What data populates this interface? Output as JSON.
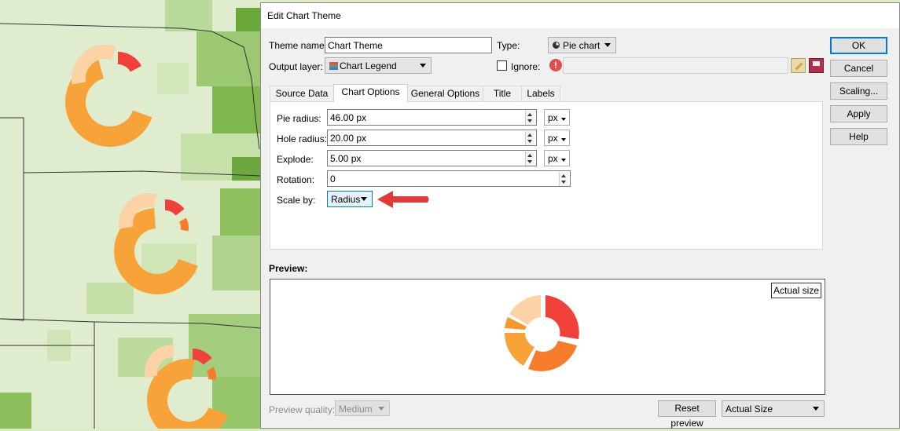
{
  "dialog": {
    "title": "Edit Chart Theme",
    "theme_name_label": "Theme name:",
    "theme_name_value": "Chart Theme",
    "type_label": "Type:",
    "type_value": "Pie chart",
    "output_layer_label": "Output layer:",
    "output_layer_value": "Chart Legend",
    "ignore_label": "Ignore:",
    "ignore_value": "",
    "buttons": {
      "ok": "OK",
      "cancel": "Cancel",
      "scaling": "Scaling...",
      "apply": "Apply",
      "help": "Help"
    },
    "tabs": [
      "Source Data",
      "Chart Options",
      "General Options",
      "Title",
      "Labels"
    ],
    "active_tab": "Chart Options",
    "chart_options": {
      "pie_radius_label": "Pie radius:",
      "pie_radius_value": "46.00 px",
      "pie_radius_unit": "px",
      "hole_radius_label": "Hole radius:",
      "hole_radius_value": "20.00 px",
      "hole_radius_unit": "px",
      "explode_label": "Explode:",
      "explode_value": "5.00 px",
      "explode_unit": "px",
      "rotation_label": "Rotation:",
      "rotation_value": "0",
      "scale_by_label": "Scale by:",
      "scale_by_value": "Radius"
    },
    "preview": {
      "label": "Preview:",
      "actual_size_badge": "Actual size",
      "quality_label": "Preview quality:",
      "quality_value": "Medium",
      "reset_button": "Reset preview",
      "size_value": "Actual Size"
    }
  },
  "colors": {
    "accent_arrow": "#e23a3a",
    "pie_red": "#f0403a",
    "pie_orange": "#f57c2a",
    "pie_light_orange": "#f7a33a",
    "pie_peach": "#fbd3a6",
    "map_green": "#6fae3e",
    "map_light": "#dfeccd"
  }
}
